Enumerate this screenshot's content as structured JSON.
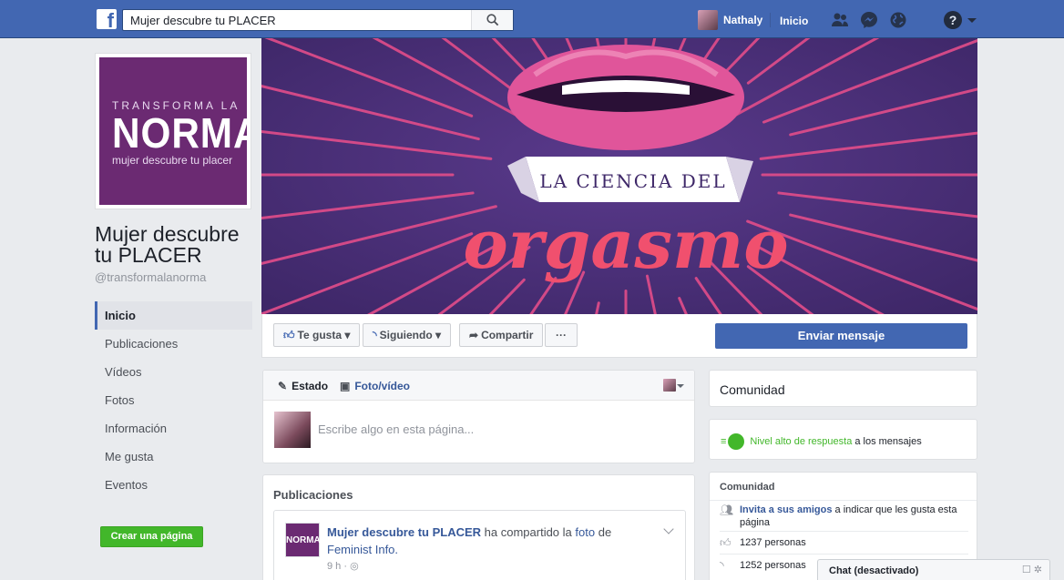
{
  "topbar": {
    "logo": "f",
    "search_value": "Mujer descubre tu PLACER",
    "user_name": "Nathaly",
    "home_label": "Inicio",
    "help_glyph": "?"
  },
  "profile": {
    "logo_line1": "TRANSFORMA LA",
    "logo_line2": "NORMA",
    "logo_line3": "mujer descubre tu placer",
    "name": "Mujer descubre tu PLACER",
    "handle": "@transformalanorma"
  },
  "nav": {
    "items": [
      {
        "label": "Inicio"
      },
      {
        "label": "Publicaciones"
      },
      {
        "label": "Vídeos"
      },
      {
        "label": "Fotos"
      },
      {
        "label": "Información"
      },
      {
        "label": "Me gusta"
      },
      {
        "label": "Eventos"
      }
    ],
    "create_page": "Crear una página"
  },
  "cover": {
    "banner_text": "LA CIENCIA DEL",
    "script_text": "orgasmo",
    "bg_color": "#4a2f7a",
    "ray_color": "#e24d8a"
  },
  "actions": {
    "like": "Te gusta",
    "follow": "Siguiendo",
    "share": "Compartir",
    "more": "···",
    "send_message": "Enviar mensaje"
  },
  "composer": {
    "tab_status": "Estado",
    "tab_photo": "Foto/vídeo",
    "placeholder": "Escribe algo en esta página..."
  },
  "posts": {
    "title": "Publicaciones",
    "first": {
      "avatar_text": "NORMA",
      "author": "Mujer descubre tu PLACER",
      "action": "ha compartido la",
      "object": "foto",
      "preposition": "de",
      "source": "Feminist Info.",
      "time": "9 h · ◎"
    }
  },
  "right": {
    "community_title": "Comunidad",
    "response_highlight": "Nivel alto de respuesta",
    "response_rest": "a los mensajes",
    "community2_title": "Comunidad",
    "invite_link": "Invita a sus amigos",
    "invite_rest": "a indicar que les gusta esta página",
    "likes": "1237 personas",
    "follows": "1252 personas"
  },
  "chat": {
    "label": "Chat (desactivado)",
    "icons": "☐ ✲"
  },
  "colors": {
    "brand": "#4267b2",
    "green": "#42b72a",
    "link": "#365899"
  }
}
